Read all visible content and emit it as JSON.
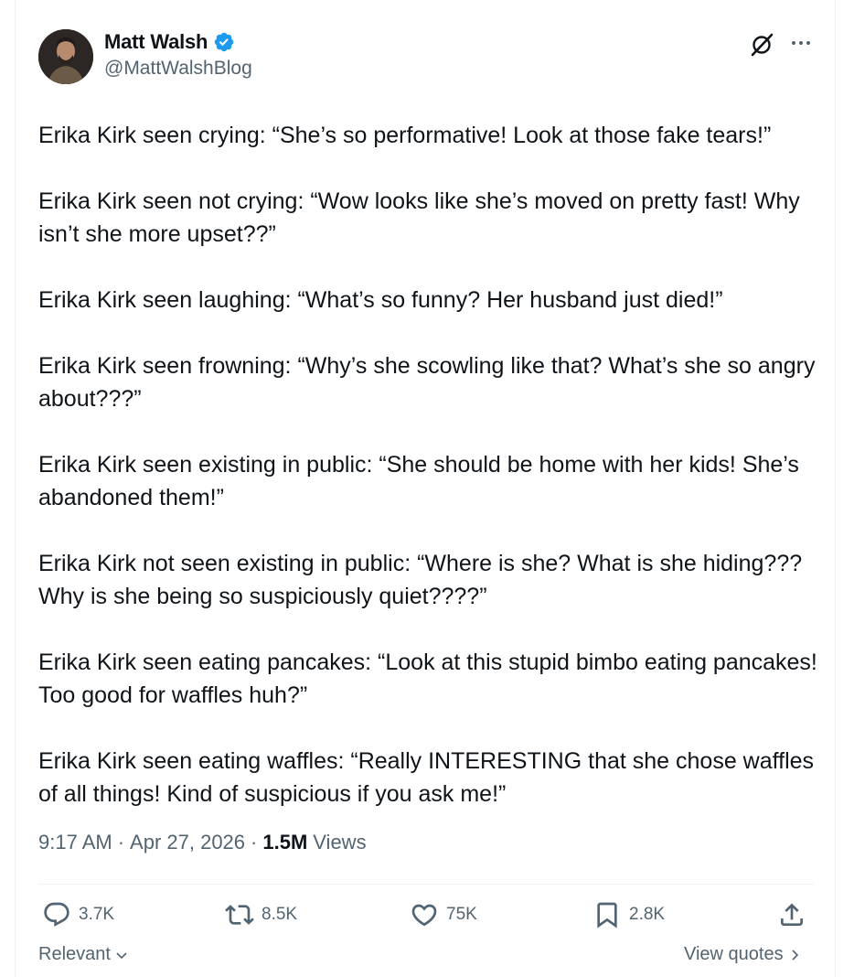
{
  "author": {
    "display_name": "Matt Walsh",
    "handle": "@MattWalshBlog",
    "verified": true,
    "verified_color": "#1d9bf0"
  },
  "tweet": {
    "paragraphs": [
      "Erika Kirk seen crying: “She’s so performative! Look at those fake tears!”",
      "Erika Kirk seen not crying: “Wow looks like she’s moved on pretty fast! Why isn’t she more upset??”",
      "Erika Kirk seen laughing: “What’s so funny? Her husband just died!”",
      "Erika Kirk seen frowning: “Why’s she scowling like that? What’s she so angry about???”",
      "Erika Kirk seen existing in public: “She should be home with her kids! She’s abandoned them!”",
      "Erika Kirk not seen existing in public: “Where is she? What is she hiding??? Why is she being so suspiciously quiet????”",
      "Erika Kirk seen eating pancakes: “Look at this stupid bimbo eating pancakes! Too good for waffles huh?”",
      "Erika Kirk seen eating waffles: “Really INTERESTING that she chose waffles of all things! Kind of suspicious if you ask me!”"
    ],
    "time": "9:17 AM",
    "date": "Apr 27, 2026",
    "separator": "·",
    "views_count": "1.5M",
    "views_label": "Views"
  },
  "actions": {
    "replies": "3.7K",
    "reposts": "8.5K",
    "likes": "75K",
    "bookmarks": "2.8K"
  },
  "footer": {
    "sort_label": "Relevant",
    "view_quotes": "View quotes"
  },
  "icons": {
    "grok": "grok-icon",
    "more": "more-icon",
    "reply": "reply-icon",
    "repost": "repost-icon",
    "like": "heart-icon",
    "bookmark": "bookmark-icon",
    "share": "share-icon"
  }
}
